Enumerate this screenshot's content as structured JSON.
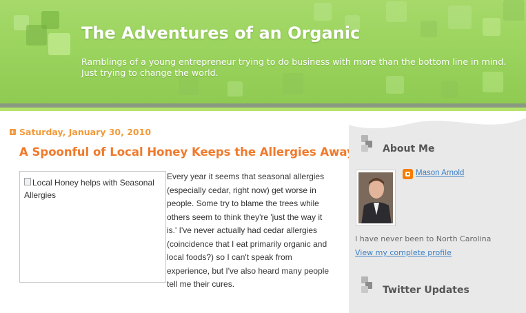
{
  "header": {
    "title": "The Adventures of an Organic",
    "description": "Ramblings of a young entrepreneur trying to do business with more than the bottom line in mind. Just trying to change the world."
  },
  "post": {
    "date": "Saturday, January 30, 2010",
    "title": "A Spoonful of Local Honey Keeps the Allergies Away",
    "image_alt": "Local Honey helps with Seasonal Allergies",
    "body": "Every year it seems that seasonal allergies (especially cedar, right now) get worse in people. Some try to blame the trees while others seem to think they're 'just the way it is.' I've never actually had cedar allergies (coincidence that I eat primarily organic and local foods?) so I can't speak from experience, but I've also heard many people tell me their cures."
  },
  "sidebar": {
    "about": {
      "title": "About Me",
      "name": "Mason Arnold",
      "about_text": "I have never been to North Carolina",
      "profile_link": "View my complete profile"
    },
    "twitter": {
      "title": "Twitter Updates"
    }
  },
  "icons": {
    "date_toggle": "plus-square-icon",
    "widget": "stacked-squares-icon",
    "blogger": "blogger-icon",
    "broken_image": "broken-image-icon"
  },
  "colors": {
    "header_green": "#9bd45e",
    "accent_orange": "#f07a2c",
    "date_orange": "#f29a3a",
    "link_blue": "#3b7fc4",
    "sidebar_grey": "#e9e9e9"
  }
}
